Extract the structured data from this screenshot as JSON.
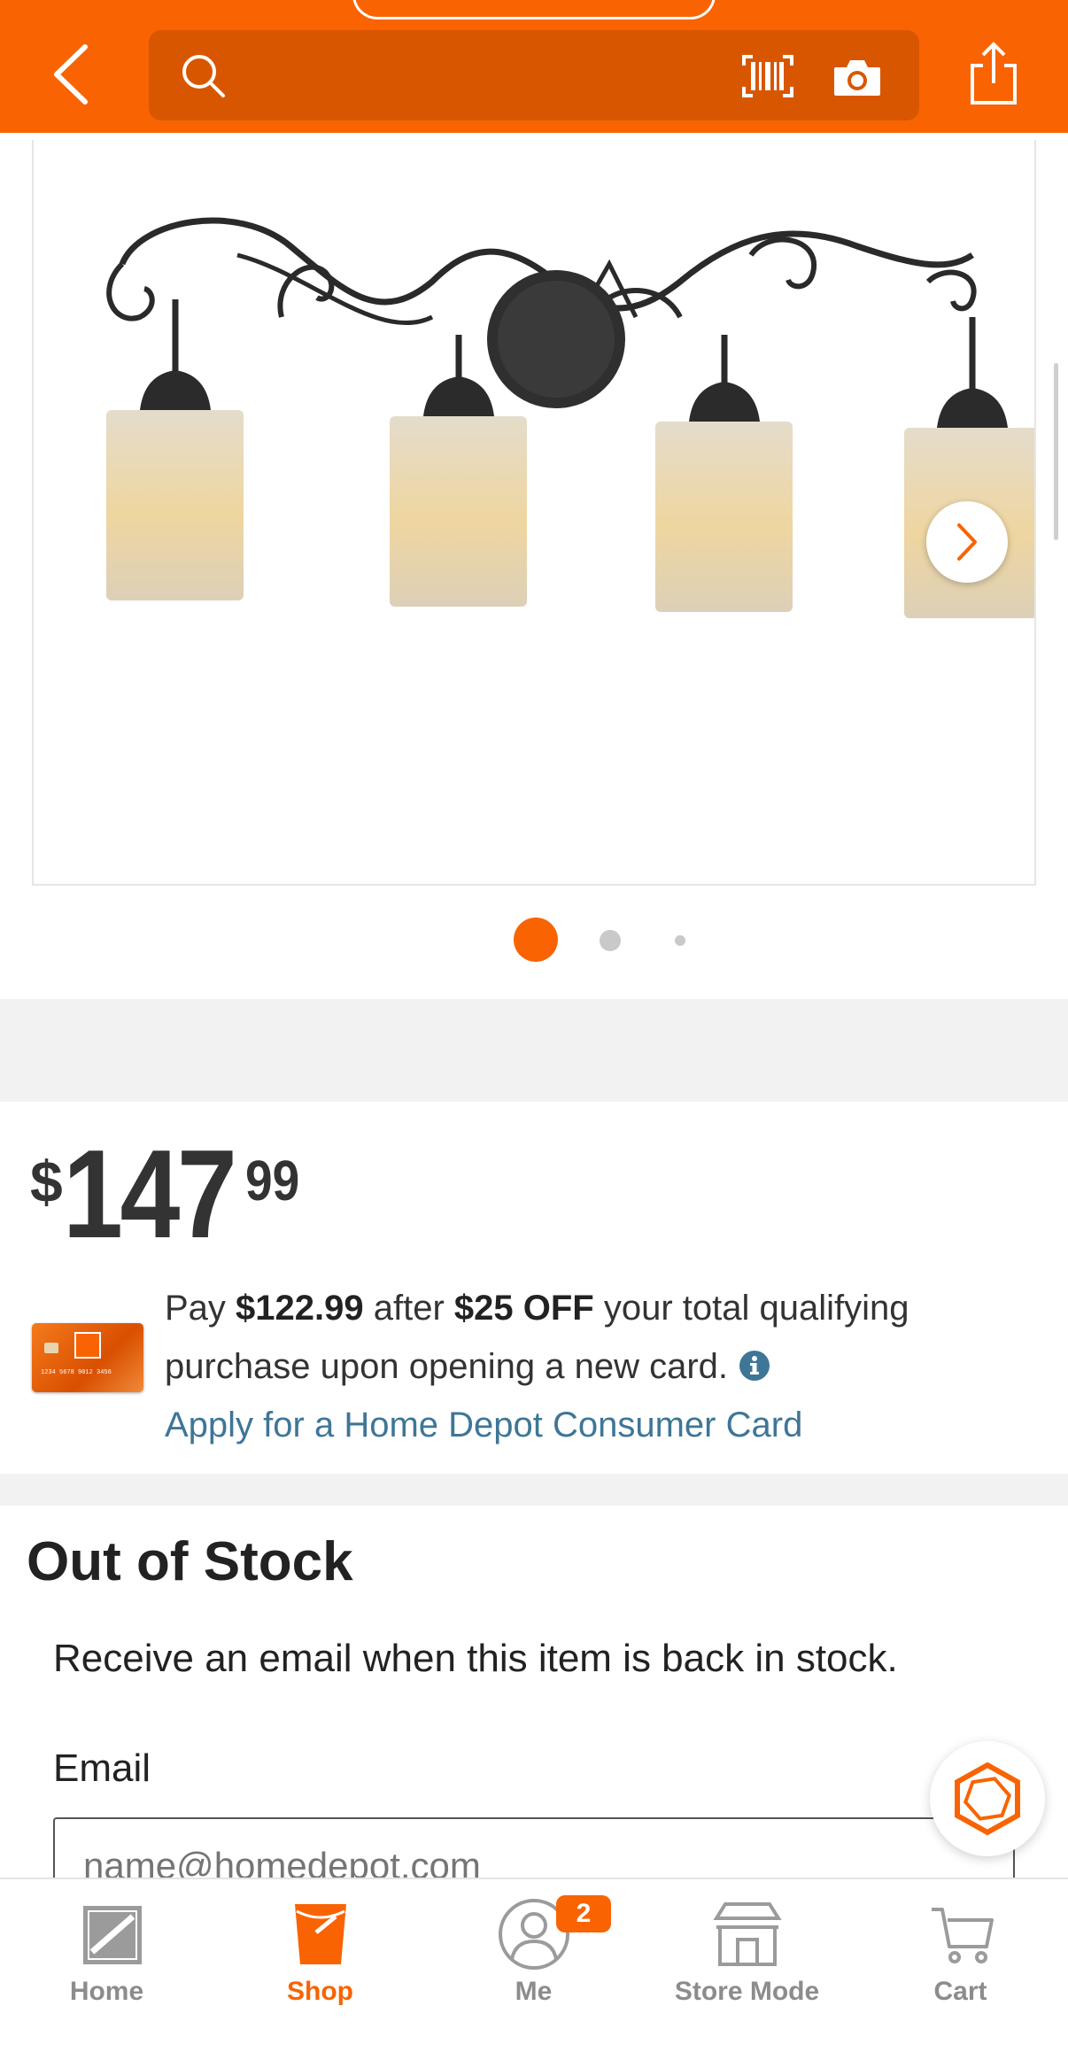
{
  "colors": {
    "brand": "#f96302",
    "link": "#3e7697",
    "carousel_inactive": "#c9c9c9"
  },
  "header": {
    "back_icon": "chevron-left-icon",
    "search_placeholder": "",
    "search_icon": "search-icon",
    "barcode_icon": "barcode-scan-icon",
    "camera_icon": "camera-icon",
    "share_icon": "share-icon"
  },
  "gallery": {
    "image_alt": "four-light vanity light with scroll arms",
    "next_icon": "chevron-right-icon",
    "active_slide": 1,
    "slide_count": 3
  },
  "price": {
    "currency": "$",
    "dollars": "147",
    "cents": "99"
  },
  "promo": {
    "pay_prefix": "Pay ",
    "pay_amount": "$122.99",
    "after_text": " after ",
    "discount": "$25 OFF",
    "rest": " your total qualifying purchase upon opening a new card.",
    "info_icon": "info-icon",
    "apply_link": "Apply for a Home Depot Consumer Card",
    "card_number": "1234 5678 9012 3456"
  },
  "stock": {
    "title": "Out of Stock",
    "description": "Receive an email when this item is back in stock.",
    "email_label": "Email",
    "email_placeholder": "name@homedepot.com"
  },
  "chat": {
    "icon": "chat-assistant-icon"
  },
  "nav": {
    "items": [
      {
        "label": "Home",
        "icon": "home-depot-logo-icon",
        "active": false
      },
      {
        "label": "Shop",
        "icon": "bucket-icon",
        "active": true
      },
      {
        "label": "Me",
        "icon": "user-icon",
        "active": false,
        "badge": "2"
      },
      {
        "label": "Store Mode",
        "icon": "store-icon",
        "active": false
      },
      {
        "label": "Cart",
        "icon": "cart-icon",
        "active": false
      }
    ]
  }
}
